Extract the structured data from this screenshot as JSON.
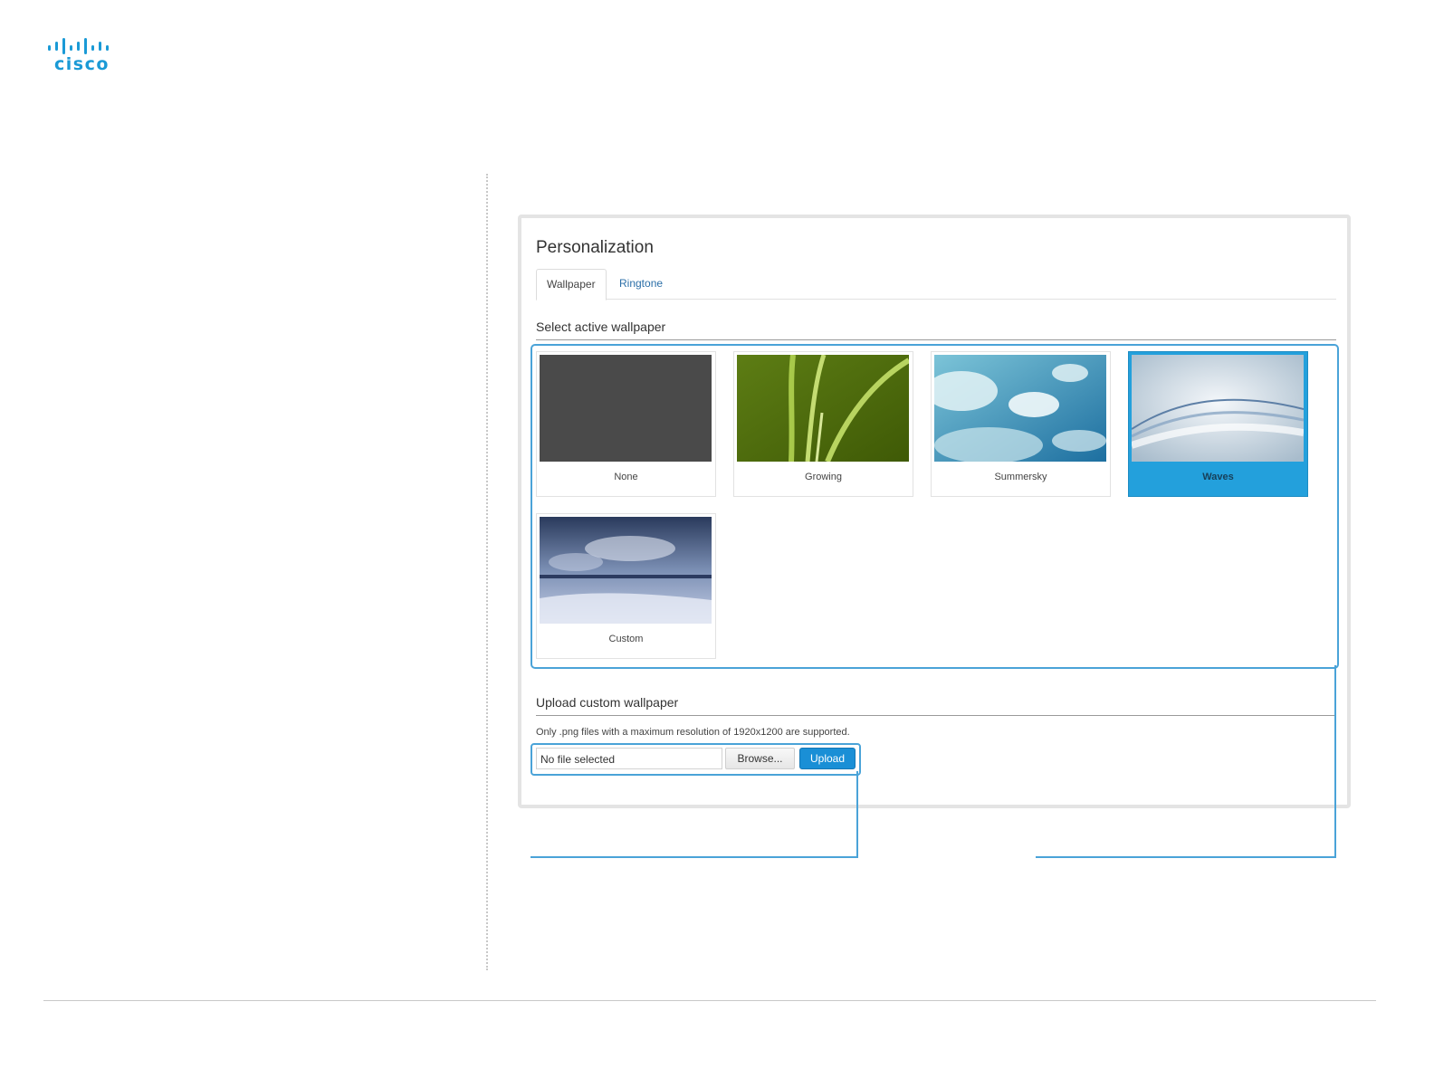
{
  "brand": {
    "logo_text": "cisco",
    "accent_color": "#1a9ad6"
  },
  "panel": {
    "title": "Personalization",
    "tabs": [
      {
        "label": "Wallpaper",
        "active": true
      },
      {
        "label": "Ringtone",
        "active": false
      }
    ],
    "wallpaper_section": {
      "title": "Select active wallpaper",
      "options": [
        {
          "label": "None",
          "selected": false,
          "thumb": "solid-gray"
        },
        {
          "label": "Growing",
          "selected": false,
          "thumb": "green-grass"
        },
        {
          "label": "Summersky",
          "selected": false,
          "thumb": "blue-sky-clouds"
        },
        {
          "label": "Waves",
          "selected": true,
          "thumb": "white-blue-waves"
        },
        {
          "label": "Custom",
          "selected": false,
          "thumb": "cloudy-beach"
        }
      ]
    },
    "upload_section": {
      "title": "Upload custom wallpaper",
      "hint": "Only .png files with a maximum resolution of 1920x1200 are supported.",
      "file_field_value": "No file selected",
      "browse_label": "Browse...",
      "upload_label": "Upload"
    }
  }
}
